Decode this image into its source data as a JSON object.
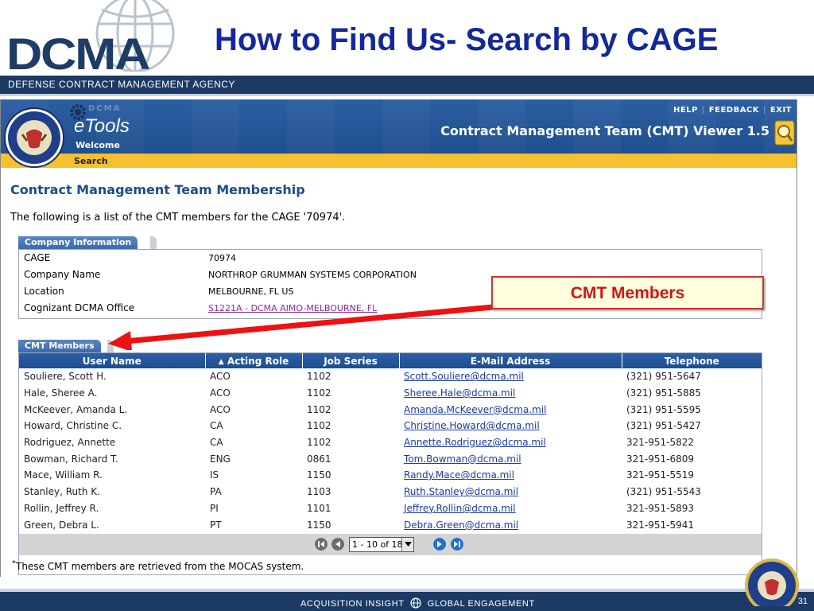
{
  "slide": {
    "logo_text": "DCMA",
    "title": "How to Find Us- Search by CAGE",
    "agency_name": "DEFENSE CONTRACT MANAGEMENT AGENCY",
    "tagline_left": "ACQUISITION INSIGHT",
    "tagline_right": "GLOBAL ENGAGEMENT",
    "page_number": "31"
  },
  "app": {
    "brand_small": "DCMA",
    "brand_name": "eTools",
    "welcome": "Welcome",
    "nav_item": "Search",
    "links": [
      "HELP",
      "FEEDBACK",
      "EXIT"
    ],
    "title": "Contract Management Team (CMT) Viewer 1.5"
  },
  "page": {
    "heading": "Contract Management Team Membership",
    "description": "The following is a list of the CMT members for the CAGE '70974'."
  },
  "company": {
    "tab_label": "Company Information",
    "rows": [
      {
        "label": "CAGE",
        "value": "70974"
      },
      {
        "label": "Company Name",
        "value": "NORTHROP GRUMMAN SYSTEMS CORPORATION"
      },
      {
        "label": "Location",
        "value": "MELBOURNE, FL US"
      },
      {
        "label": "Cognizant DCMA Office",
        "value": "S1221A - DCMA AIMO-MELBOURNE, FL"
      }
    ]
  },
  "members": {
    "tab_label": "CMT Members",
    "columns": [
      "User Name",
      "Acting Role",
      "Job Series",
      "E-Mail Address",
      "Telephone"
    ],
    "sort_indicator": "▲",
    "rows": [
      {
        "name": "Souliere, Scott H.",
        "role": "ACO",
        "series": "1102",
        "email": "Scott.Souliere@dcma.mil",
        "phone": "(321) 951-5647"
      },
      {
        "name": "Hale, Sheree A.",
        "role": "ACO",
        "series": "1102",
        "email": "Sheree.Hale@dcma.mil",
        "phone": "(321) 951-5885"
      },
      {
        "name": "McKeever, Amanda L.",
        "role": "ACO",
        "series": "1102",
        "email": "Amanda.McKeever@dcma.mil",
        "phone": "(321) 951-5595"
      },
      {
        "name": "Howard, Christine C.",
        "role": "CA",
        "series": "1102",
        "email": "Christine.Howard@dcma.mil",
        "phone": "(321) 951-5427"
      },
      {
        "name": "Rodriguez, Annette",
        "role": "CA",
        "series": "1102",
        "email": "Annette.Rodriguez@dcma.mil",
        "phone": "321-951-5822"
      },
      {
        "name": "Bowman, Richard T.",
        "role": "ENG",
        "series": "0861",
        "email": "Tom.Bowman@dcma.mil",
        "phone": "321-951-6809"
      },
      {
        "name": "Mace, William R.",
        "role": "IS",
        "series": "1150",
        "email": "Randy.Mace@dcma.mil",
        "phone": "321-951-5519"
      },
      {
        "name": "Stanley, Ruth K.",
        "role": "PA",
        "series": "1103",
        "email": "Ruth.Stanley@dcma.mil",
        "phone": "(321) 951-5543"
      },
      {
        "name": "Rollin, Jeffrey R.",
        "role": "PI",
        "series": "1101",
        "email": "Jeffrey.Rollin@dcma.mil",
        "phone": "321-951-5893"
      },
      {
        "name": "Green, Debra L.",
        "role": "PT",
        "series": "1150",
        "email": "Debra.Green@dcma.mil",
        "phone": "321-951-5941"
      }
    ],
    "pager_value": "1 - 10 of 18",
    "footnote_mark": "*",
    "footnote": "These CMT members are retrieved from the MOCAS system."
  },
  "callout": {
    "text": "CMT Members"
  },
  "colors": {
    "title_blue": "#14289a",
    "navy_bar": "#1c3a64",
    "banner_blue": "#2b5ea2",
    "nav_yellow": "#f5c12e",
    "header_blue": "#1e4e91",
    "callout_red": "#d41414"
  }
}
